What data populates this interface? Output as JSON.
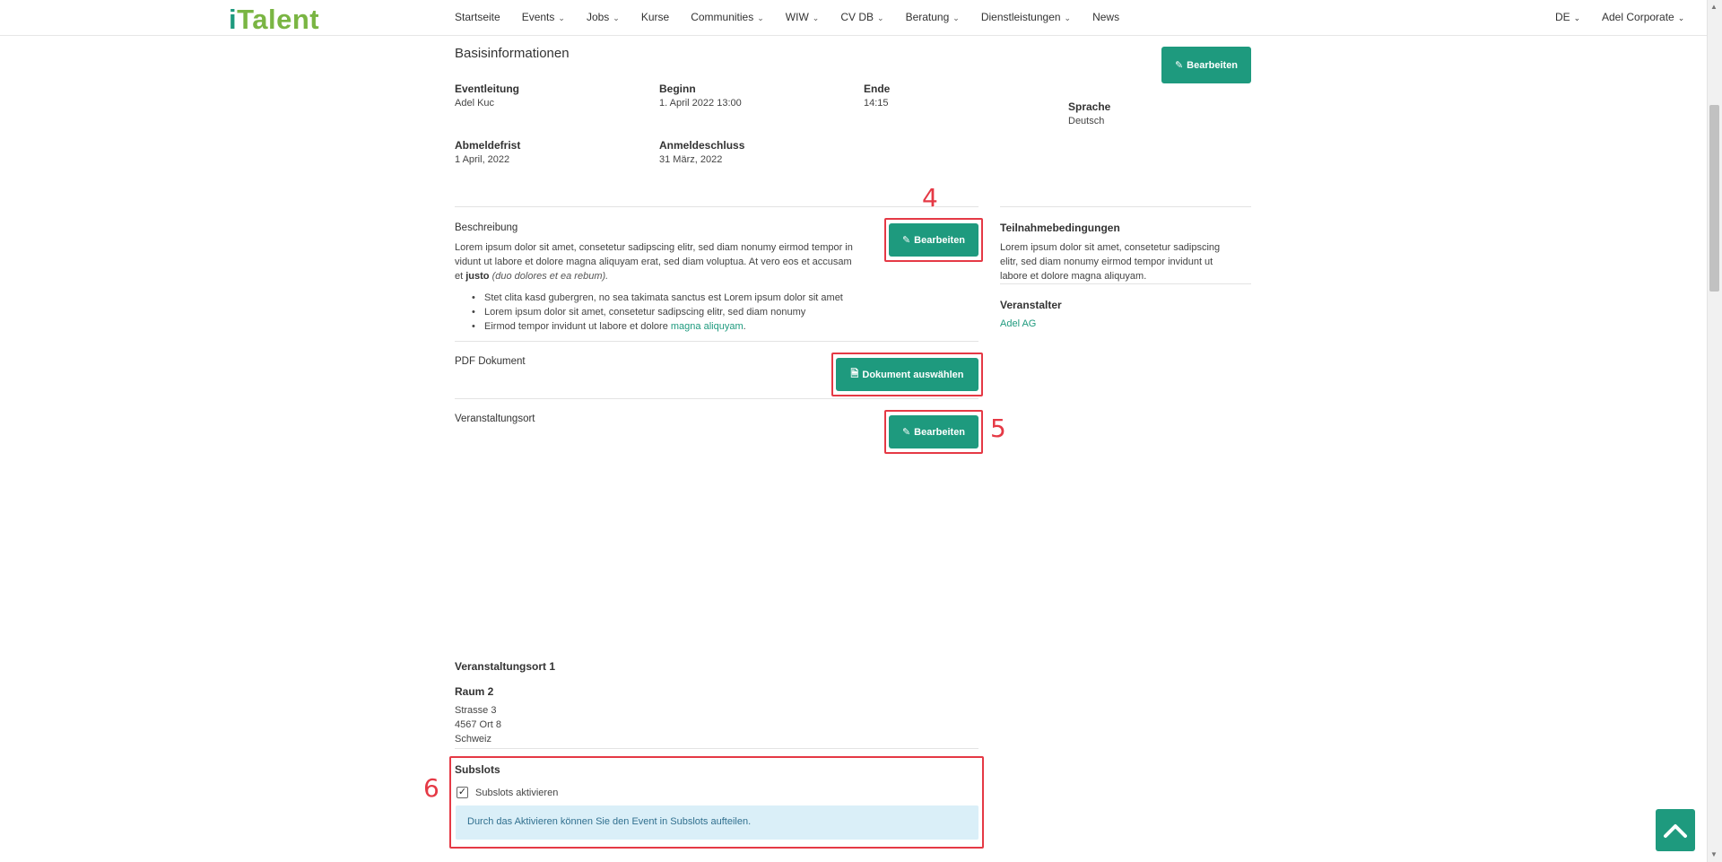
{
  "brand": {
    "logo_i": "i",
    "logo_rest": "Talent"
  },
  "nav": {
    "items": [
      {
        "label": "Startseite",
        "caret": ""
      },
      {
        "label": "Events",
        "caret": "⌄"
      },
      {
        "label": "Jobs",
        "caret": "⌄"
      },
      {
        "label": "Kurse",
        "caret": ""
      },
      {
        "label": "Communities",
        "caret": "⌄"
      },
      {
        "label": "WIW",
        "caret": "⌄"
      },
      {
        "label": "CV DB",
        "caret": "⌄"
      },
      {
        "label": "Beratung",
        "caret": "⌄"
      },
      {
        "label": "Dienstleistungen",
        "caret": "⌄"
      },
      {
        "label": "News",
        "caret": ""
      }
    ],
    "language": "DE",
    "account": "Adel Corporate",
    "caret": "⌄"
  },
  "basis": {
    "title": "Basisinformationen",
    "edit_label": "Bearbeiten",
    "eventleitung_label": "Eventleitung",
    "eventleitung_value": "Adel Kuc",
    "beginn_label": "Beginn",
    "beginn_value": "1. April 2022 13:00",
    "ende_label": "Ende",
    "ende_value": "14:15",
    "sprache_label": "Sprache",
    "sprache_value": "Deutsch",
    "abmeldefrist_label": "Abmeldefrist",
    "abmeldefrist_value": "1 April, 2022",
    "anmeldeschluss_label": "Anmeldeschluss",
    "anmeldeschluss_value": "31 März, 2022"
  },
  "beschreibung": {
    "title": "Beschreibung",
    "edit_label": "Bearbeiten",
    "line1": "Lorem ipsum dolor sit amet, consetetur sadipscing elitr, sed diam nonumy eirmod tempor in",
    "line2": "vidunt ut labore et dolore magna aliquyam erat, sed diam voluptua. At vero eos et accusam",
    "line3_prefix": "et ",
    "line3_bold": "justo",
    "line3_italic": "(duo dolores et ea rebum).",
    "bullets": [
      "Stet clita kasd gubergren, no sea takimata sanctus est Lorem ipsum dolor sit amet",
      "Lorem ipsum dolor sit amet, consetetur sadipscing elitr, sed diam nonumy"
    ],
    "bullet3_prefix": "Eirmod tempor invidunt ut labore et dolore ",
    "bullet3_link": "magna aliquyam",
    "bullet3_suffix": "."
  },
  "teilnahme": {
    "title": "Teilnahmebedingungen",
    "line1": "Lorem ipsum dolor sit amet, consetetur sadipscing",
    "line2": "elitr, sed diam nonumy eirmod tempor invidunt ut",
    "line3": "labore et dolore magna aliquyam."
  },
  "veranstalter": {
    "title": "Veranstalter",
    "value": "Adel AG"
  },
  "pdf": {
    "title": "PDF Dokument",
    "button_label": "Dokument auswählen"
  },
  "ort": {
    "title": "Veranstaltungsort",
    "edit_label": "Bearbeiten",
    "ort1_title": "Veranstaltungsort 1",
    "raum": "Raum 2",
    "strasse": "Strasse 3",
    "plz_ort": "4567 Ort 8",
    "land": "Schweiz"
  },
  "subslots": {
    "title": "Subslots",
    "checkbox_label": "Subslots aktivieren",
    "checked_mark": "✓",
    "info": "Durch das Aktivieren können Sie den Event in Subslots aufteilen."
  },
  "callouts": {
    "four": "4",
    "five": "5",
    "six": "6"
  },
  "colors": {
    "accent": "#1e9a7e",
    "logo_green": "#7ab543",
    "annotation_red": "#e53945",
    "info_bg": "#daeff8"
  }
}
